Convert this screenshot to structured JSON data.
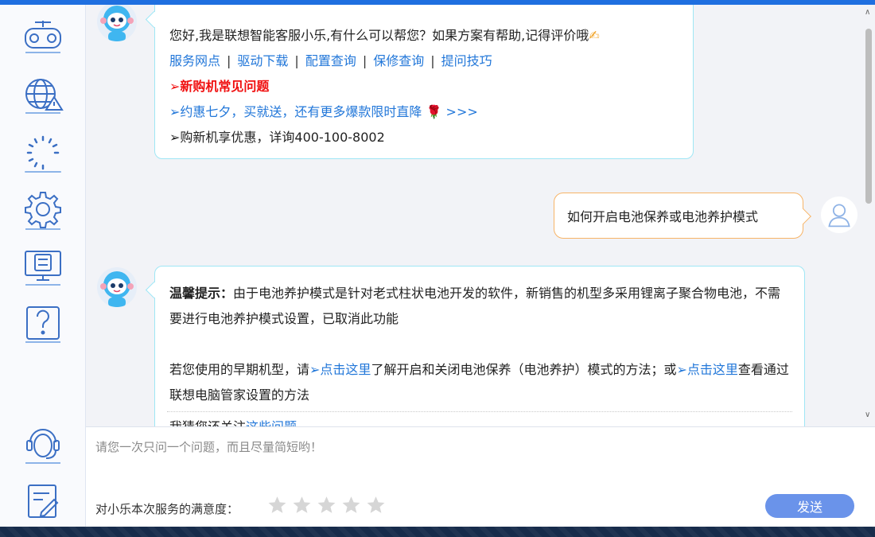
{
  "sidebar": {
    "items": [
      {
        "icon": "gamepad-icon"
      },
      {
        "icon": "globe-warning-icon"
      },
      {
        "icon": "loading-spinner-icon"
      },
      {
        "icon": "gear-icon"
      },
      {
        "icon": "monitor-settings-icon"
      },
      {
        "icon": "question-icon"
      },
      {
        "icon": "customer-service-headset-icon"
      },
      {
        "icon": "feedback-edit-icon"
      }
    ]
  },
  "messages": {
    "bot1": {
      "greeting": "您好,我是联想智能客服小乐,有什么可以帮您？如果方案有帮助,记得评价哦",
      "links": [
        "服务网点",
        "驱动下载",
        "配置查询",
        "保修查询",
        "提问技巧"
      ],
      "separator": "|",
      "line_new_machine": "➢新购机常见问题",
      "line_promo": "➢约惠七夕，买就送，还有更多爆款限时直降",
      "line_promo_arrows": ">>>",
      "line_hotline": "➢购新机享优惠，详询400-100-8002"
    },
    "user1": {
      "text": "如何开启电池保养或电池养护模式"
    },
    "bot2": {
      "tip_label": "温馨提示：",
      "tip_text": "由于电池养护模式是针对老式柱状电池开发的软件，新销售的机型多采用锂离子聚合物电池，不需要进行电池养护模式设置，已取消此功能",
      "p2_prefix": "若您使用的早期机型，请",
      "p2_link1": "➢点击这里",
      "p2_mid": "了解开启和关闭电池保养（电池养护）模式的方法；或",
      "p2_link2": "➢点击这里",
      "p2_suffix": "查看通过联想电脑管家设置的方法",
      "guess_prefix": "我猜您还关注",
      "guess_link": "这些问题"
    }
  },
  "input": {
    "placeholder": "请您一次只问一个问题，而且尽量简短哟！",
    "rating_label": "对小乐本次服务的满意度：",
    "rating_stars_total": 5,
    "rating_value": 0,
    "send_label": "发送"
  },
  "colors": {
    "accent": "#1f6fe0",
    "link": "#2277d9",
    "bot_border": "#9fe6f5",
    "user_border": "#f7b467",
    "send_button": "#6a93ea",
    "alert": "#f01010"
  }
}
